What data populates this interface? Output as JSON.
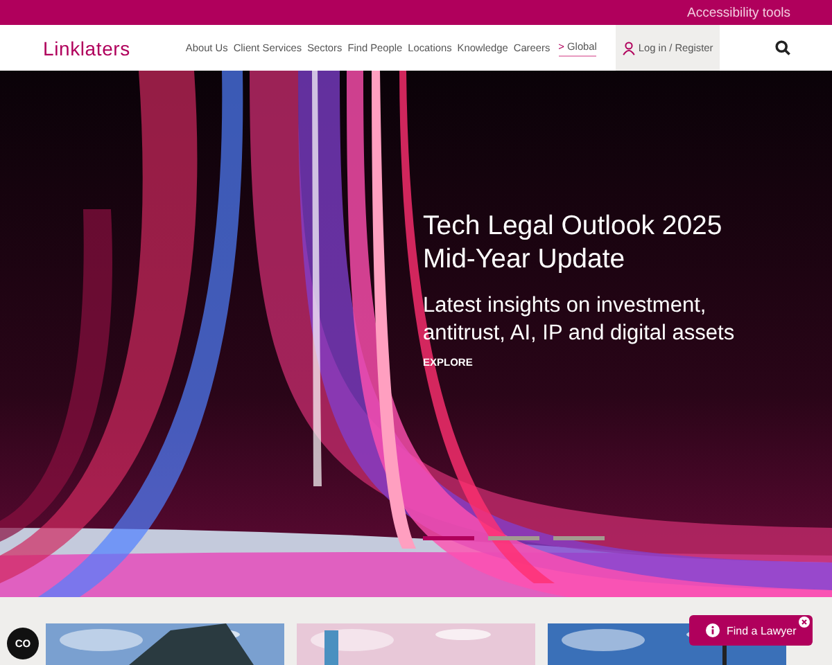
{
  "top_bar": {
    "link": "Accessibility tools"
  },
  "nav": {
    "logo": "Linklaters",
    "items": [
      {
        "label": "About Us"
      },
      {
        "label": "Client Services"
      },
      {
        "label": "Sectors"
      },
      {
        "label": "Find People"
      },
      {
        "label": "Locations"
      },
      {
        "label": "Knowledge"
      },
      {
        "label": "Careers"
      }
    ],
    "region": {
      "prefix": ">",
      "label": "Global"
    },
    "login": "Log in / Register"
  },
  "hero": {
    "title_lines": [
      "Tech Legal Outlook 2025",
      "Mid-Year Update"
    ],
    "subtitle_lines": [
      "Latest insights on investment,",
      "antitrust, AI, IP and digital assets"
    ],
    "cta": "EXPLORE",
    "slides": [
      {
        "selected": true
      },
      {
        "selected": false
      },
      {
        "selected": false
      }
    ]
  },
  "cookie_button": "CO",
  "find_lawyer": {
    "label": "Find a Lawyer"
  }
}
